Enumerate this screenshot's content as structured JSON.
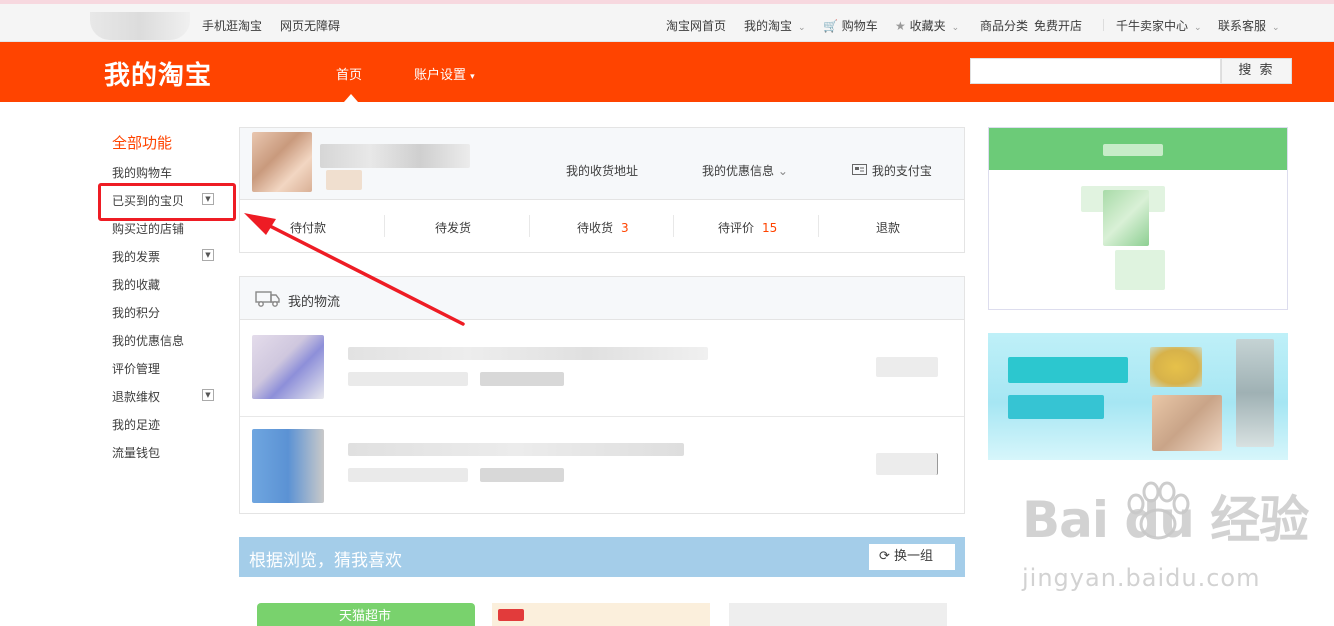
{
  "topbar": {
    "mobile": "手机逛淘宝",
    "accessible": "网页无障碍",
    "home": "淘宝网首页",
    "my_taobao": "我的淘宝",
    "cart": "购物车",
    "favorites": "收藏夹",
    "categories": "商品分类",
    "open_shop": "免费开店",
    "seller_center": "千牛卖家中心",
    "contact": "联系客服"
  },
  "header": {
    "logo": "我的淘宝",
    "nav_home": "首页",
    "nav_account": "账户设置",
    "search_button": "搜 索",
    "search_value": ""
  },
  "sidebar": {
    "title": "全部功能",
    "items": [
      {
        "label": "我的购物车"
      },
      {
        "label": "已买到的宝贝"
      },
      {
        "label": "购买过的店铺"
      },
      {
        "label": "我的发票"
      },
      {
        "label": "我的收藏"
      },
      {
        "label": "我的积分"
      },
      {
        "label": "我的优惠信息"
      },
      {
        "label": "评价管理"
      },
      {
        "label": "退款维权"
      },
      {
        "label": "我的足迹"
      },
      {
        "label": "流量钱包"
      }
    ]
  },
  "profile": {
    "address": "我的收货地址",
    "coupons": "我的优惠信息",
    "alipay": "我的支付宝",
    "tabs": [
      {
        "label": "待付款",
        "count": ""
      },
      {
        "label": "待发货",
        "count": ""
      },
      {
        "label": "待收货",
        "count": "3"
      },
      {
        "label": "待评价",
        "count": "15"
      },
      {
        "label": "退款",
        "count": ""
      }
    ]
  },
  "logistics": {
    "title": "我的物流"
  },
  "guess": {
    "title": "根据浏览，猜我喜欢",
    "refresh": "换一组",
    "tmall_label": "天猫超市"
  },
  "watermark": {
    "brand": "Bai  du 经验",
    "url": "jingyan.baidu.com"
  },
  "colors": {
    "brand": "#ff4400",
    "highlight": "#ee1c24",
    "guess_bar": "#a4cde9"
  }
}
